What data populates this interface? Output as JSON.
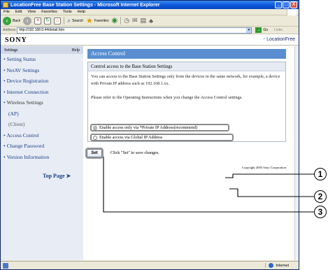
{
  "window": {
    "title": "LocationFree Base Station Settings - Microsoft Internet Explorer",
    "controls": [
      "_",
      "□",
      "X"
    ]
  },
  "menu": [
    "File",
    "Edit",
    "View",
    "Favorites",
    "Tools",
    "Help"
  ],
  "toolbar": {
    "back_label": "Back",
    "search_label": "Search",
    "favorites_label": "Favorites"
  },
  "address": {
    "label": "Address",
    "url": "http://192.168.0.44/detail.htm",
    "go_label": "Go",
    "links_label": "Links"
  },
  "header": {
    "brand": "SONY",
    "product": "LocationFree"
  },
  "sidebar": {
    "heading": "Settings",
    "help": "Help",
    "items": [
      "Setting Status",
      "NetAV Settings",
      "Device Registration",
      "Internet Connection",
      "Wireless Settings",
      "(AP)",
      "(Client)",
      "Access Control",
      "Change Password",
      "Version Information"
    ],
    "top_page": "Top Page"
  },
  "main": {
    "heading": "Access Control",
    "box_heading": "Control access to the Base Station Settings",
    "description": "You can access to the Base Station Settings only from the devices in the same network, for example, a device with Private IP address such as 192.168.1.xx.",
    "refer": "Please refer to the Operating Instructions when you change the Access Control settings.",
    "option1": "Enable access only via *Private IP Address(recommend)",
    "option2": "Enable access via Global IP Address",
    "set_button": "Set",
    "set_hint": "Click \"Set\" to save changes.",
    "copyright": "Copyright 2005 Sony Corporation"
  },
  "status": {
    "zone": "Internet"
  },
  "callouts": [
    "1",
    "2",
    "3"
  ]
}
